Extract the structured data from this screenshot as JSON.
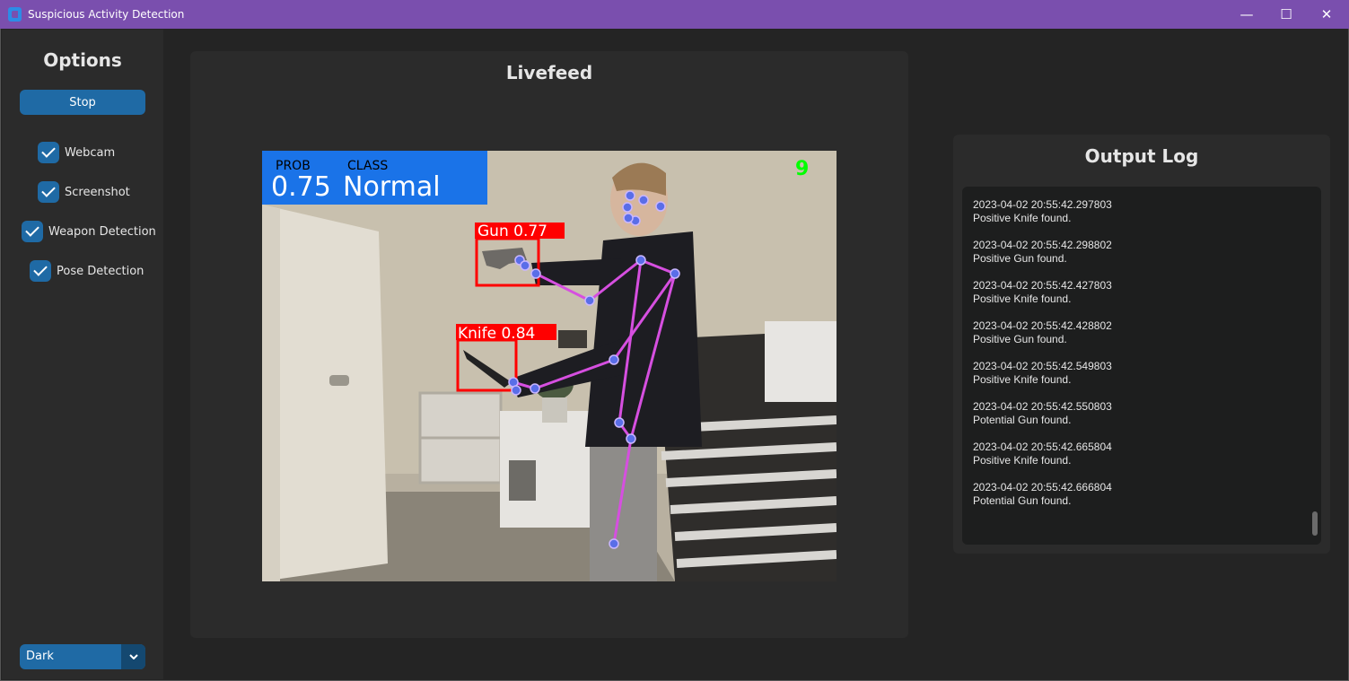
{
  "window": {
    "title": "Suspicious Activity Detection",
    "controls": {
      "minimize": "—",
      "maximize": "☐",
      "close": "✕"
    }
  },
  "sidebar": {
    "heading": "Options",
    "stop_label": "Stop",
    "checkboxes": [
      {
        "label": "Webcam",
        "checked": true
      },
      {
        "label": "Screenshot",
        "checked": true
      },
      {
        "label": "Weapon Detection",
        "checked": true
      },
      {
        "label": "Pose Detection",
        "checked": true
      }
    ],
    "appearance_value": "Dark"
  },
  "livefeed": {
    "heading": "Livefeed",
    "overlay": {
      "prob_header": "PROB",
      "class_header": "CLASS",
      "prob_value": "0.75",
      "class_value": "Normal",
      "frame_counter": "9",
      "detections": [
        {
          "label": "Gun 0.77"
        },
        {
          "label": "Knife 0.84"
        }
      ]
    }
  },
  "output_log": {
    "heading": "Output Log",
    "entries": [
      {
        "timestamp": "2023-04-02 20:55:42.297803",
        "message": "Positive Knife found."
      },
      {
        "timestamp": "2023-04-02 20:55:42.298802",
        "message": "Positive Gun found."
      },
      {
        "timestamp": "2023-04-02 20:55:42.427803",
        "message": "Positive Knife found."
      },
      {
        "timestamp": "2023-04-02 20:55:42.428802",
        "message": "Positive Gun found."
      },
      {
        "timestamp": "2023-04-02 20:55:42.549803",
        "message": "Positive Knife found."
      },
      {
        "timestamp": "2023-04-02 20:55:42.550803",
        "message": "Potential Gun found."
      },
      {
        "timestamp": "2023-04-02 20:55:42.665804",
        "message": "Positive Knife found."
      },
      {
        "timestamp": "2023-04-02 20:55:42.666804",
        "message": "Potential Gun found."
      }
    ]
  },
  "colors": {
    "accent": "#1f6aa5",
    "titlebar": "#7a4fae",
    "detection_box": "#ff0000",
    "skeleton": "#d64fe0",
    "keypoint": "#5a6ee8",
    "overlay_panel": "#1a73e8",
    "frame_counter": "#00ff00"
  }
}
